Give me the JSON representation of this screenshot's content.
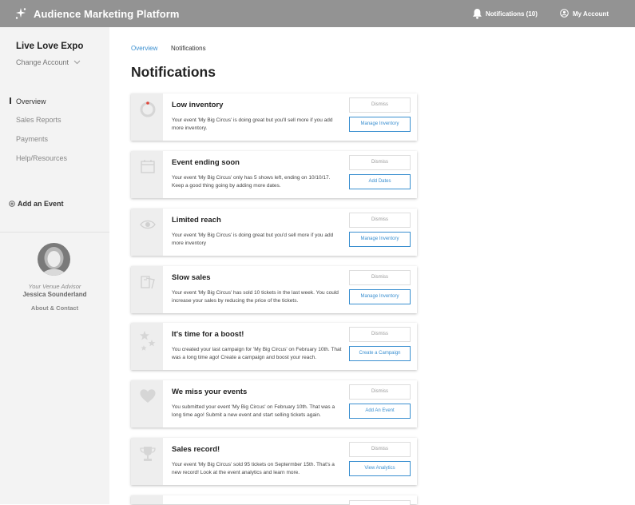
{
  "header": {
    "app_title": "Audience Marketing Platform",
    "notifications_label": "Notifications (10)",
    "account_label": "My Account"
  },
  "sidebar": {
    "account_name": "Live Love Expo",
    "change_account": "Change Account",
    "nav": [
      {
        "label": "Overview",
        "active": true
      },
      {
        "label": "Sales Reports"
      },
      {
        "label": "Payments"
      },
      {
        "label": "Help/Resources"
      }
    ],
    "add_event": "Add an Event",
    "advisor_label": "Your Venue Advisor",
    "advisor_name": "Jessica Sounderland",
    "about": "About & Contact"
  },
  "main": {
    "tabs": [
      {
        "label": "Overview",
        "active": true
      },
      {
        "label": "Notifications"
      }
    ],
    "title": "Notifications",
    "dismiss_label": "Dismiss",
    "notifications": [
      {
        "icon": "ring-icon",
        "title": "Low inventory",
        "desc": "Your event 'My Big Circus' is doing great but you'll sell more if you add more inventory.",
        "action": "Manage Inventory"
      },
      {
        "icon": "calendar-icon",
        "title": "Event ending soon",
        "desc": "Your event 'My Big Circus' only has 5 shows left, ending on 10/10/17. Keep a good thing going by adding more dates.",
        "action": "Add Dates"
      },
      {
        "icon": "eye-icon",
        "title": "Limited reach",
        "desc": "Your event 'My Big Circus' is doing great but you'd sell more if you add more inventory",
        "action": "Manage Inventory"
      },
      {
        "icon": "tickets-icon",
        "title": "Slow sales",
        "desc": "Your event 'My Big Circus' has sold 10 tickets in the last week. You could increase your sales by reducing the price of the tickets.",
        "action": "Manage Inventory"
      },
      {
        "icon": "stars-icon",
        "title": "It's time for a boost!",
        "desc": "You created your last campaign for 'My Big Circus' on February 10th. That was a long time ago! Create a campaign and boost your reach.",
        "action": "Create a Campaign"
      },
      {
        "icon": "heart-icon",
        "title": "We miss your events",
        "desc": "You submitted your event 'My Big Circus' on February 10th. That was a long time ago! Submit a new event and start selling tickets again.",
        "action": "Add An Event"
      },
      {
        "icon": "trophy-icon",
        "title": "Sales record!",
        "desc": "Your event 'My Big Circus' sold 95 tickets on Septermber 15th. That's a new record! Look at the event analytics and learn more.",
        "action": "View Analytics"
      }
    ]
  }
}
